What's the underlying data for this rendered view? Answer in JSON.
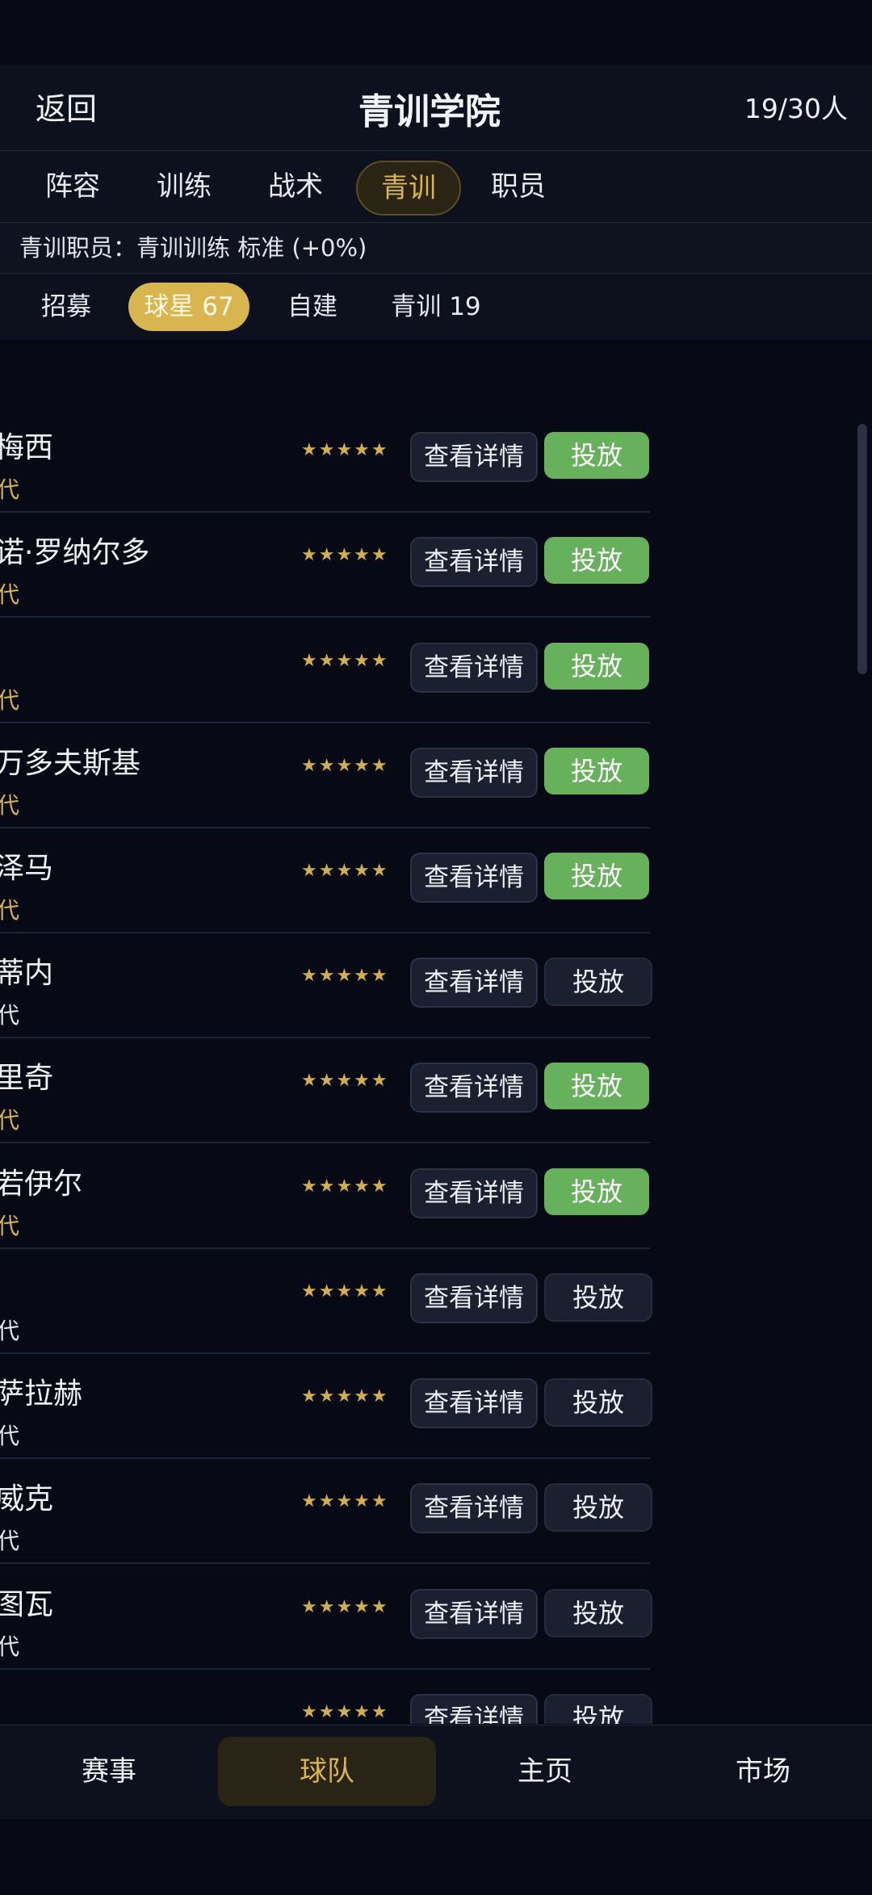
{
  "header": {
    "back_label": "返回",
    "title": "青训学院",
    "count": "19/30人"
  },
  "tabs": [
    {
      "label": "阵容",
      "active": false
    },
    {
      "label": "训练",
      "active": false
    },
    {
      "label": "战术",
      "active": false
    },
    {
      "label": "青训",
      "active": true
    },
    {
      "label": "职员",
      "active": false
    }
  ],
  "staff_info": "青训职员：青训训练 标准 (+0%)",
  "filters": [
    {
      "label": "招募",
      "active": false
    },
    {
      "label": "球星 67",
      "active": true
    },
    {
      "label": "自建",
      "active": false
    },
    {
      "label": "青训 19",
      "active": false
    }
  ],
  "players": [
    {
      "name": "梅西",
      "sub": "代",
      "sub_color": "gold",
      "stars": "★★★★★",
      "detail_label": "查看详情",
      "loan_label": "投放",
      "loan_enabled": true
    },
    {
      "name": "诺·罗纳尔多",
      "sub": "代",
      "sub_color": "gold",
      "stars": "★★★★★",
      "detail_label": "查看详情",
      "loan_label": "投放",
      "loan_enabled": true
    },
    {
      "name": "",
      "sub": "代",
      "sub_color": "gold",
      "stars": "★★★★★",
      "detail_label": "查看详情",
      "loan_label": "投放",
      "loan_enabled": true
    },
    {
      "name": "万多夫斯基",
      "sub": "代",
      "sub_color": "gold",
      "stars": "★★★★★",
      "detail_label": "查看详情",
      "loan_label": "投放",
      "loan_enabled": true
    },
    {
      "name": "泽马",
      "sub": "代",
      "sub_color": "gold",
      "stars": "★★★★★",
      "detail_label": "查看详情",
      "loan_label": "投放",
      "loan_enabled": true
    },
    {
      "name": "蒂内",
      "sub": "代",
      "sub_color": "white",
      "stars": "★★★★★",
      "detail_label": "查看详情",
      "loan_label": "投放",
      "loan_enabled": false
    },
    {
      "name": "里奇",
      "sub": "代",
      "sub_color": "gold",
      "stars": "★★★★★",
      "detail_label": "查看详情",
      "loan_label": "投放",
      "loan_enabled": true
    },
    {
      "name": "若伊尔",
      "sub": "代",
      "sub_color": "gold",
      "stars": "★★★★★",
      "detail_label": "查看详情",
      "loan_label": "投放",
      "loan_enabled": true
    },
    {
      "name": "",
      "sub": "代",
      "sub_color": "white",
      "stars": "★★★★★",
      "detail_label": "查看详情",
      "loan_label": "投放",
      "loan_enabled": false
    },
    {
      "name": "萨拉赫",
      "sub": "代",
      "sub_color": "white",
      "stars": "★★★★★",
      "detail_label": "查看详情",
      "loan_label": "投放",
      "loan_enabled": false
    },
    {
      "name": "威克",
      "sub": "代",
      "sub_color": "white",
      "stars": "★★★★★",
      "detail_label": "查看详情",
      "loan_label": "投放",
      "loan_enabled": false
    },
    {
      "name": "图瓦",
      "sub": "代",
      "sub_color": "white",
      "stars": "★★★★★",
      "detail_label": "查看详情",
      "loan_label": "投放",
      "loan_enabled": false
    },
    {
      "name": "",
      "sub": "",
      "sub_color": "white",
      "stars": "★★★★★",
      "detail_label": "查看详情",
      "loan_label": "投放",
      "loan_enabled": false
    }
  ],
  "bottom_nav": [
    {
      "label": "赛事",
      "active": false
    },
    {
      "label": "球队",
      "active": true
    },
    {
      "label": "主页",
      "active": false
    },
    {
      "label": "市场",
      "active": false
    }
  ],
  "colors": {
    "background": "#070a14",
    "gold": "#d9b452",
    "green": "#67b05c"
  }
}
